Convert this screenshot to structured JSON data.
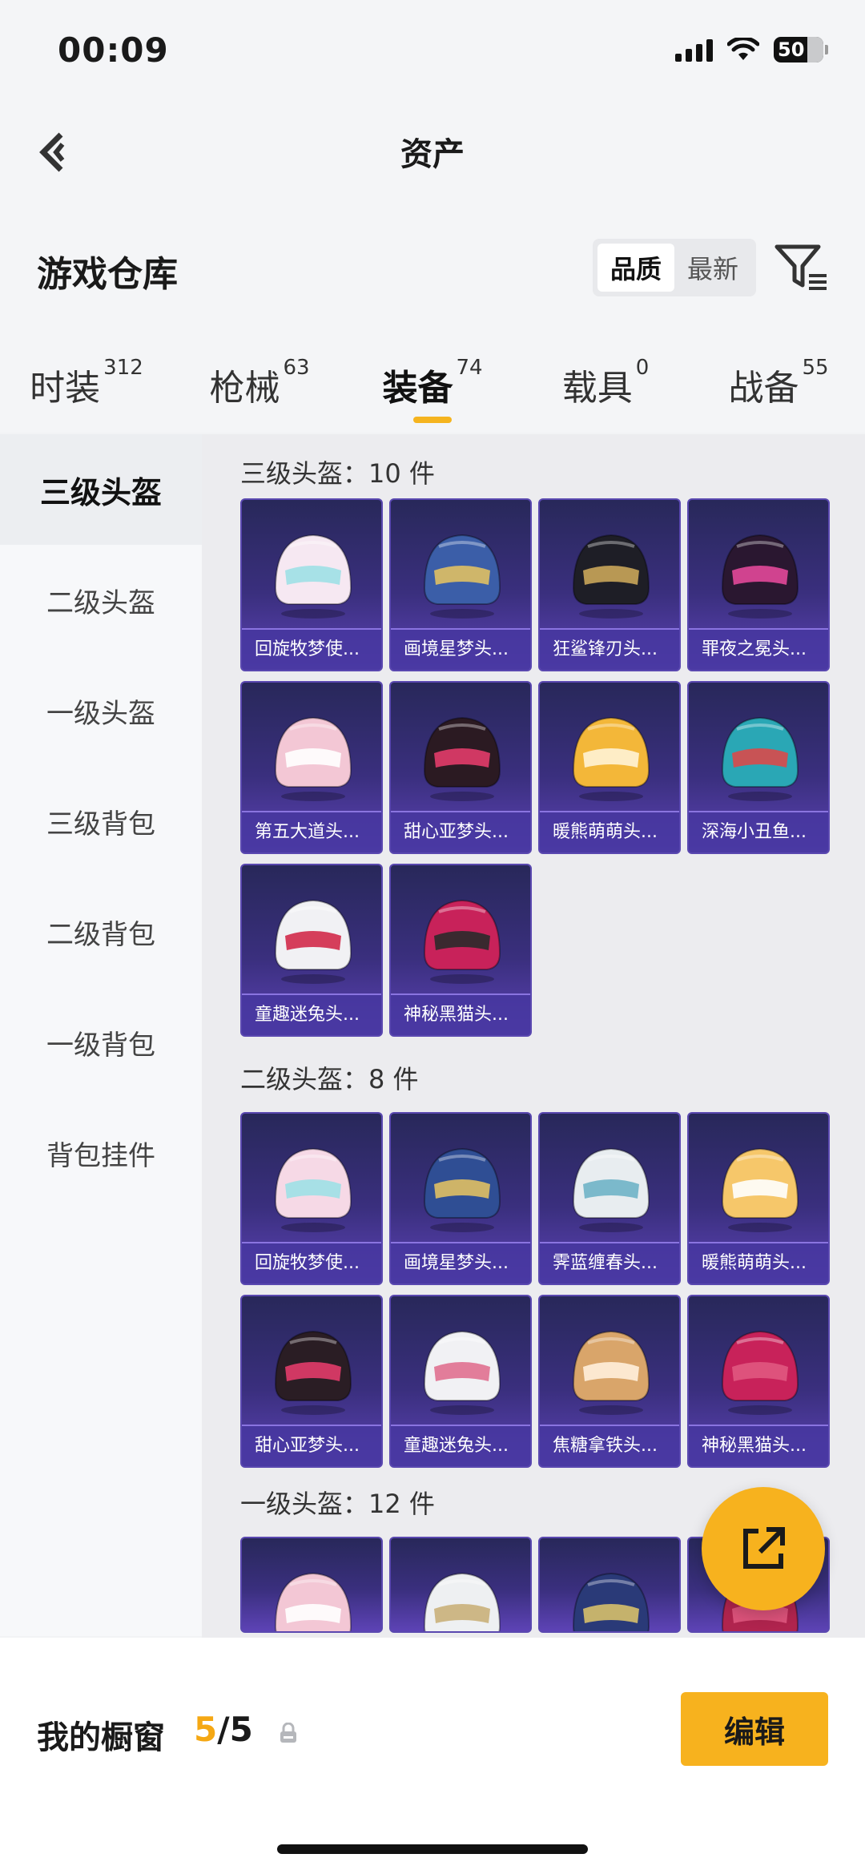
{
  "status_bar": {
    "time": "00:09",
    "battery": "50"
  },
  "header": {
    "title": "资产"
  },
  "warehouse": {
    "title": "游戏仓库",
    "sort_options": [
      "品质",
      "最新"
    ],
    "active_sort": "品质"
  },
  "category_tabs": [
    {
      "label": "时装",
      "count": "312"
    },
    {
      "label": "枪械",
      "count": "63"
    },
    {
      "label": "装备",
      "count": "74",
      "active": true
    },
    {
      "label": "载具",
      "count": "0"
    },
    {
      "label": "战备",
      "count": "55"
    }
  ],
  "sub_nav": [
    "三级头盔",
    "二级头盔",
    "一级头盔",
    "三级背包",
    "二级背包",
    "一级背包",
    "背包挂件"
  ],
  "sections": [
    {
      "title": "三级头盔：10 件",
      "items": [
        "回旋牧梦使...",
        "画境星梦头...",
        "狂鲨锋刃头...",
        "罪夜之冕头...",
        "第五大道头...",
        "甜心亚梦头...",
        "暖熊萌萌头...",
        "深海小丑鱼...",
        "童趣迷兔头...",
        "神秘黑猫头..."
      ]
    },
    {
      "title": "二级头盔：8 件",
      "items": [
        "回旋牧梦使...",
        "画境星梦头...",
        "霁蓝缠春头...",
        "暖熊萌萌头...",
        "甜心亚梦头...",
        "童趣迷兔头...",
        "焦糖拿铁头...",
        "神秘黑猫头..."
      ]
    },
    {
      "title": "一级头盔：12 件",
      "items": [
        "",
        "",
        "",
        ""
      ]
    }
  ],
  "bottom_bar": {
    "label": "我的橱窗",
    "current": "5",
    "total": "/5",
    "edit_label": "编辑"
  },
  "colors": {
    "accent": "#f5b41f",
    "card_top": "#28285a",
    "card_bottom": "#5d43b6"
  }
}
